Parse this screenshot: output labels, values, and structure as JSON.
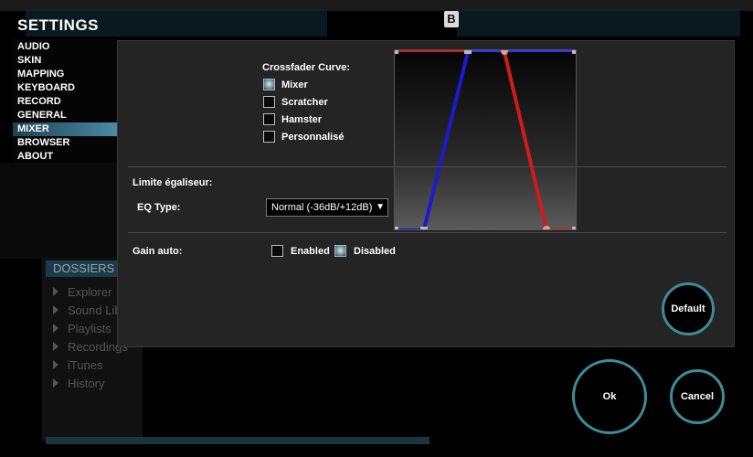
{
  "settings": {
    "title": "SETTINGS",
    "menu": [
      "AUDIO",
      "SKIN",
      "MAPPING",
      "KEYBOARD",
      "RECORD",
      "GENERAL",
      "MIXER",
      "BROWSER",
      "ABOUT"
    ],
    "active_menu": "MIXER"
  },
  "mixer": {
    "crossfader_label": "Crossfader Curve:",
    "curves": [
      {
        "label": "Mixer",
        "checked": true
      },
      {
        "label": "Scratcher",
        "checked": false
      },
      {
        "label": "Hamster",
        "checked": false
      },
      {
        "label": "Personnalisé",
        "checked": false
      }
    ],
    "eq_limit_label": "Limite égaliseur:",
    "eq_type_label": "EQ Type:",
    "eq_type_value": "Normal (-36dB/+12dB)",
    "gain_label": "Gain auto:",
    "gain_enabled_label": "Enabled",
    "gain_disabled_label": "Disabled",
    "gain_selected": "Disabled",
    "default_button": "Default"
  },
  "dialog": {
    "ok_button": "Ok",
    "cancel_button": "Cancel"
  },
  "background": {
    "deck_b_badge": "B",
    "browser_title": "DOSSIERS",
    "browser_items": [
      "Explorer",
      "Sound Lib",
      "Playlists",
      "Recordings",
      "iTunes",
      "History"
    ]
  },
  "colors": {
    "accent": "#3f8b99",
    "curve_red": "#d11a1a",
    "curve_blue": "#1a1ad1"
  }
}
